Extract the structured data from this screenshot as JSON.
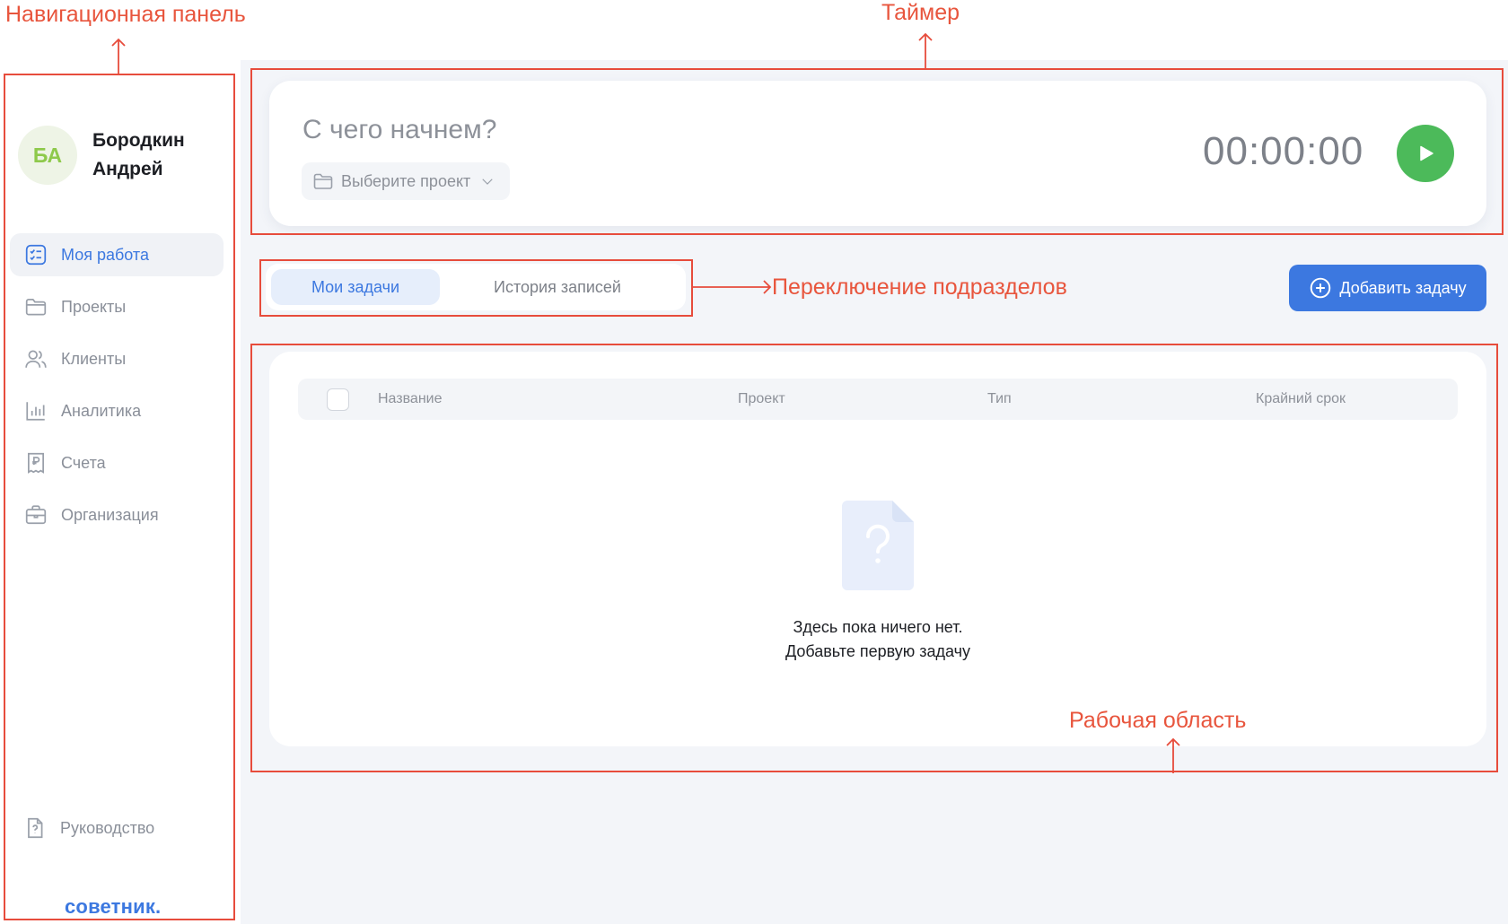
{
  "annotations": {
    "nav_panel": "Навигационная панель",
    "timer": "Таймер",
    "tab_switch": "Переключение подразделов",
    "work_area": "Рабочая область"
  },
  "profile": {
    "initials": "БА",
    "name": "Бородкин Андрей"
  },
  "sidebar": {
    "items": [
      {
        "label": "Моя работа",
        "icon": "task-list-icon",
        "active": true
      },
      {
        "label": "Проекты",
        "icon": "folder-icon",
        "active": false
      },
      {
        "label": "Клиенты",
        "icon": "users-icon",
        "active": false
      },
      {
        "label": "Аналитика",
        "icon": "bar-chart-icon",
        "active": false
      },
      {
        "label": "Счета",
        "icon": "invoice-icon",
        "active": false
      },
      {
        "label": "Организация",
        "icon": "briefcase-icon",
        "active": false
      }
    ],
    "guide": "Руководство",
    "brand": "советник."
  },
  "timer": {
    "placeholder": "С чего начнем?",
    "project_select": "Выберите проект",
    "time": "00:00:00"
  },
  "tabs": {
    "my_tasks": "Мои задачи",
    "history": "История записей"
  },
  "add_task": "Добавить задачу",
  "table": {
    "columns": [
      "Название",
      "Проект",
      "Тип",
      "Крайний срок"
    ]
  },
  "empty_state": {
    "line1": "Здесь пока ничего нет.",
    "line2": "Добавьте первую задачу"
  },
  "colors": {
    "accent": "#3c78e0",
    "play": "#4cba5a",
    "annotation": "#e74c3c",
    "avatar_text": "#8ec94b"
  }
}
